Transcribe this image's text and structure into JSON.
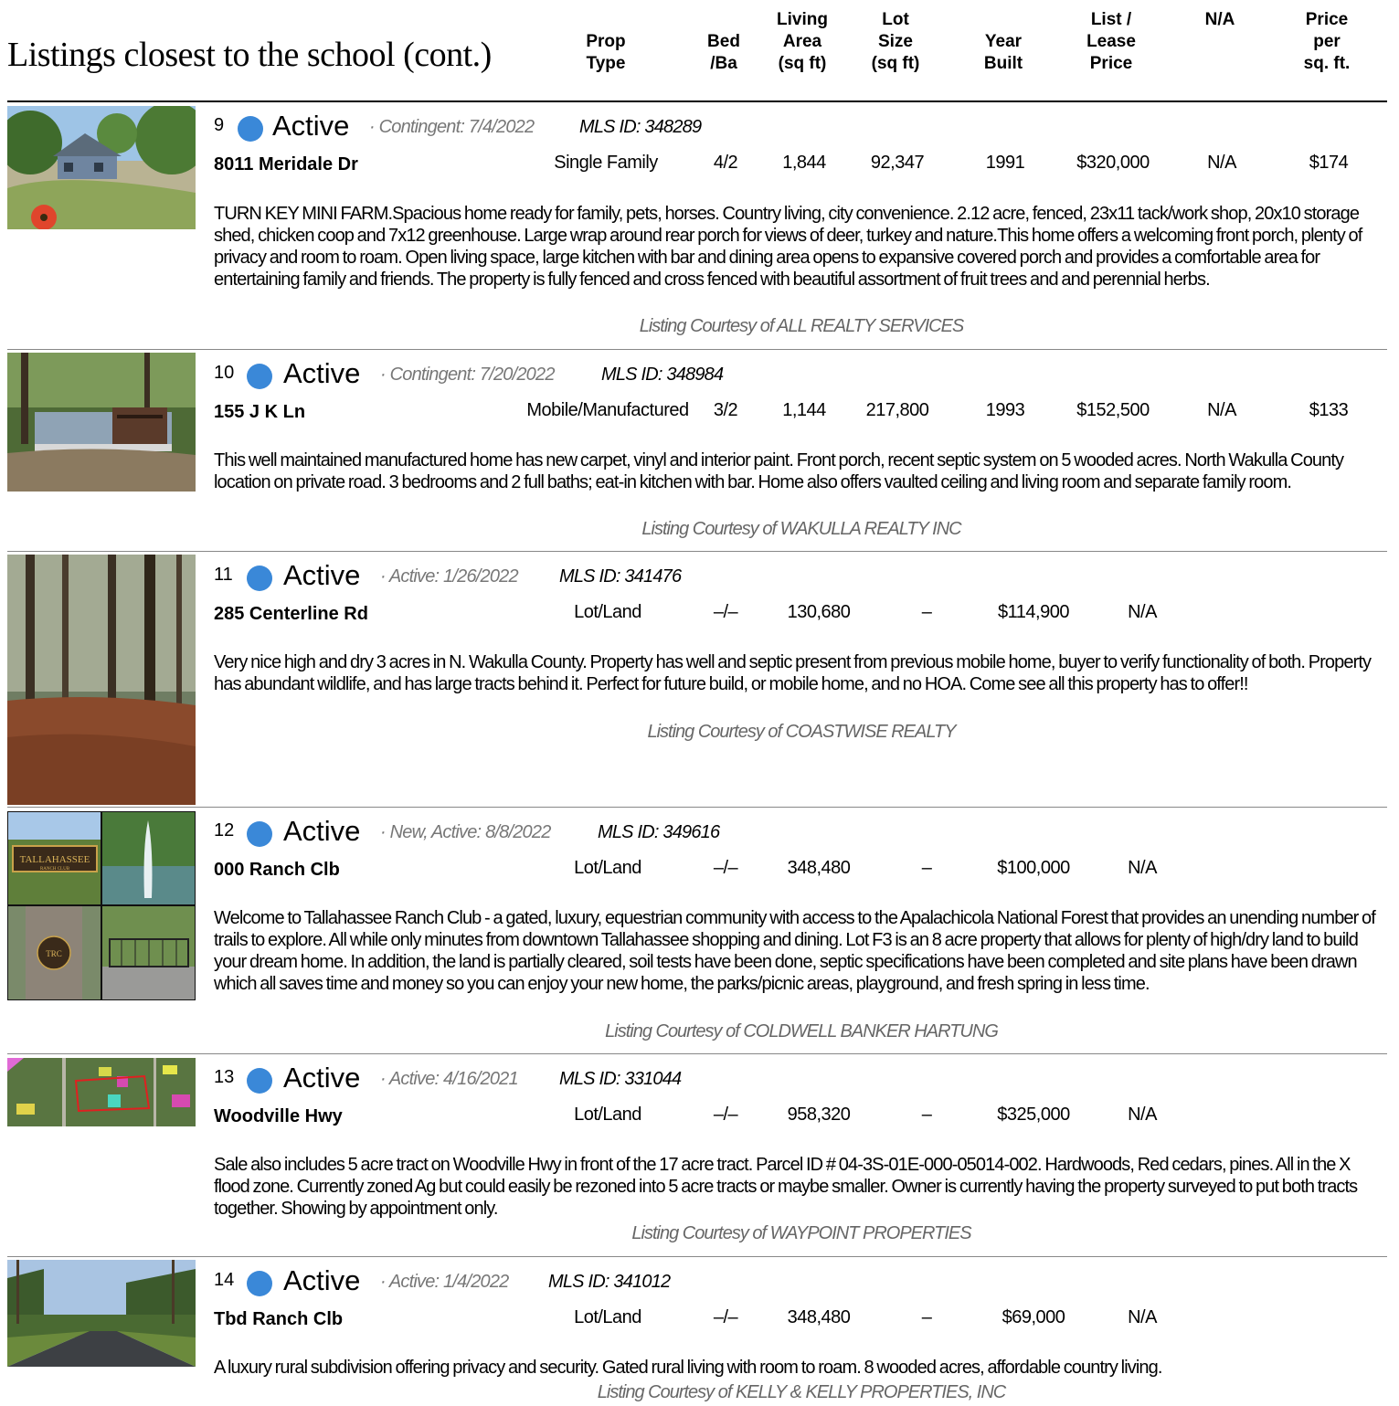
{
  "page": {
    "title": "Listings closest to the school (cont.)"
  },
  "columns": {
    "prop_type": "Prop\nType",
    "bed_ba": "Bed\n/Ba",
    "living_area": "Living\nArea\n(sq ft)",
    "lot_size": "Lot\nSize\n(sq ft)",
    "year_built": "Year\nBuilt",
    "list_price": "List /\nLease\nPrice",
    "na": "N/A",
    "price_per_sqft": "Price\nper\nsq. ft."
  },
  "listings": [
    {
      "num": "9",
      "status": "Active",
      "meta": "· Contingent: 7/4/2022",
      "mls": "MLS ID: 348289",
      "address": "8011 Meridale Dr",
      "prop_type": "Single Family",
      "bed_ba": "4/2",
      "living_area": "1,844",
      "lot_size": "92,347",
      "year_built": "1991",
      "price": "$320,000",
      "na": "N/A",
      "ppsf": "$174",
      "description": "TURN KEY MINI FARM.Spacious home ready for family, pets, horses. Country living, city convenience. 2.12 acre, fenced, 23x11 tack/work shop, 20x10 storage shed, chicken coop and 7x12 greenhouse. Large wrap around rear porch for views of deer, turkey and nature.This home offers a welcoming front porch, plenty of privacy and room to roam. Open living space, large kitchen with bar and dining area opens to expansive covered porch and provides a comfortable area for entertaining family and friends. The property is fully fenced and cross fenced with beautiful assortment of fruit trees and and perennial herbs.",
      "courtesy": "Listing Courtesy of ALL REALTY SERVICES"
    },
    {
      "num": "10",
      "status": "Active",
      "meta": "· Contingent: 7/20/2022",
      "mls": "MLS ID: 348984",
      "address": "155 J K Ln",
      "prop_type": "Mobile/Manufactured",
      "bed_ba": "3/2",
      "living_area": "1,144",
      "lot_size": "217,800",
      "year_built": "1993",
      "price": "$152,500",
      "na": "N/A",
      "ppsf": "$133",
      "description": "This well maintained manufactured home has new carpet, vinyl and interior paint. Front porch, recent septic system on 5 wooded acres. North Wakulla County location on private road. 3 bedrooms and 2 full baths; eat-in kitchen with bar. Home also offers vaulted ceiling and living room and separate family room.",
      "courtesy": "Listing Courtesy of WAKULLA REALTY INC"
    },
    {
      "num": "11",
      "status": "Active",
      "meta": "· Active: 1/26/2022",
      "mls": "MLS ID: 341476",
      "address": "285 Centerline Rd",
      "prop_type": "Lot/Land",
      "bed_ba": "–/–",
      "living_area": "130,680",
      "lot_size": "–",
      "year_built": "$114,900",
      "price": "N/A",
      "na": "",
      "ppsf": "",
      "description": "Very nice high and dry 3 acres in N. Wakulla County. Property has well and septic present from previous mobile home, buyer to verify functionality of both. Property has abundant wildlife, and has large tracts behind it. Perfect for future build, or mobile home, and no HOA. Come see all this property has to offer!!",
      "courtesy": "Listing Courtesy of COASTWISE REALTY"
    },
    {
      "num": "12",
      "status": "Active",
      "meta": "· New, Active: 8/8/2022",
      "mls": "MLS ID: 349616",
      "address": "000 Ranch Clb",
      "prop_type": "Lot/Land",
      "bed_ba": "–/–",
      "living_area": "348,480",
      "lot_size": "–",
      "year_built": "$100,000",
      "price": "N/A",
      "na": "",
      "ppsf": "",
      "description": "Welcome to Tallahassee Ranch Club - a gated, luxury, equestrian community with access to the Apalachicola National Forest that provides an unending number of trails to explore. All while only minutes from downtown Tallahassee shopping and dining. Lot F3 is an 8 acre property that allows for plenty of high/dry land to build your dream home. In addition, the land is partially cleared, soil tests have been done, septic specifications have been completed and site plans have been drawn which all saves time and money so you can enjoy your new home, the parks/picnic areas, playground, and fresh spring in less time.",
      "courtesy": "Listing Courtesy of COLDWELL BANKER HARTUNG",
      "sign_text": "TALLAHASSEE",
      "sign_sub": "RANCH CLUB",
      "stone_text": "TRC"
    },
    {
      "num": "13",
      "status": "Active",
      "meta": "· Active: 4/16/2021",
      "mls": "MLS ID: 331044",
      "address": "Woodville Hwy",
      "prop_type": "Lot/Land",
      "bed_ba": "–/–",
      "living_area": "958,320",
      "lot_size": "–",
      "year_built": "$325,000",
      "price": "N/A",
      "na": "",
      "ppsf": "",
      "description": "Sale also includes 5 acre tract on Woodville Hwy in front of the 17 acre tract. Parcel ID # 04-3S-01E-000-05014-002. Hardwoods, Red cedars, pines. All in the X flood zone. Currently zoned Ag but could easily be rezoned into 5 acre tracts or maybe smaller. Owner is currently having the property surveyed to put both tracts together. Showing by appointment only.",
      "courtesy": "Listing Courtesy of WAYPOINT PROPERTIES"
    },
    {
      "num": "14",
      "status": "Active",
      "meta": "· Active: 1/4/2022",
      "mls": "MLS ID: 341012",
      "address": "Tbd Ranch Clb",
      "prop_type": "Lot/Land",
      "bed_ba": "–/–",
      "living_area": "348,480",
      "lot_size": "–",
      "year_built": "$69,000",
      "price": "N/A",
      "na": "",
      "ppsf": "",
      "description": "A luxury rural subdivision offering privacy and security. Gated rural living with room to roam. 8 wooded acres, affordable country living.",
      "courtesy": "Listing Courtesy of KELLY & KELLY PROPERTIES, INC"
    }
  ]
}
